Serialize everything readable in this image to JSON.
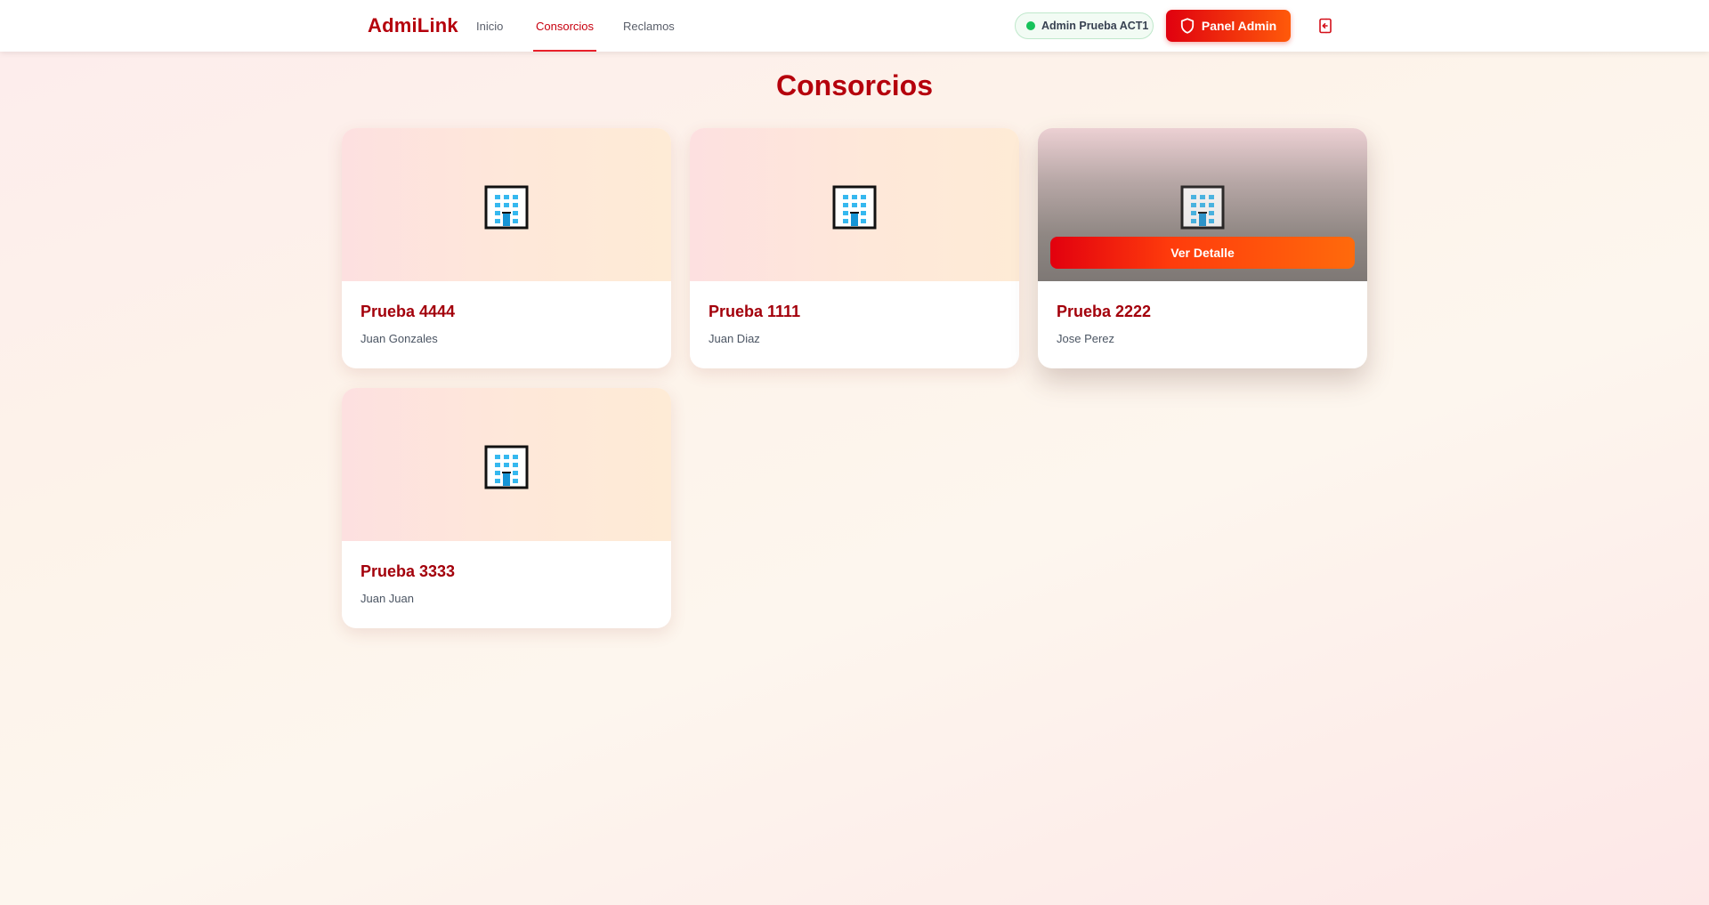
{
  "app": {
    "brand": "AdmiLink"
  },
  "nav": {
    "links": [
      {
        "label": "Inicio",
        "active": false
      },
      {
        "label": "Consorcios",
        "active": true
      },
      {
        "label": "Reclamos",
        "active": false
      }
    ],
    "user_status": "Admin Prueba ACT1",
    "user_status_color": "#16c25a",
    "admin_button": "Panel Admin",
    "admin_icon": "shield-icon",
    "logout_icon": "logout-icon"
  },
  "page": {
    "title": "Consorcios"
  },
  "consorcios": [
    {
      "name": "Prueba 4444",
      "admin": "Juan Gonzales",
      "icon": "building-icon"
    },
    {
      "name": "Prueba 1111",
      "admin": "Juan Diaz",
      "icon": "building-icon"
    },
    {
      "name": "Prueba 2222",
      "admin": "Jose Perez",
      "icon": "building-icon",
      "hovered": true,
      "action": "Ver Detalle"
    },
    {
      "name": "Prueba 3333",
      "admin": "Juan Juan",
      "icon": "building-icon"
    }
  ],
  "colors": {
    "brand": "#b5000c",
    "accent_start": "#e0000f",
    "accent_end": "#ff5a0a"
  }
}
